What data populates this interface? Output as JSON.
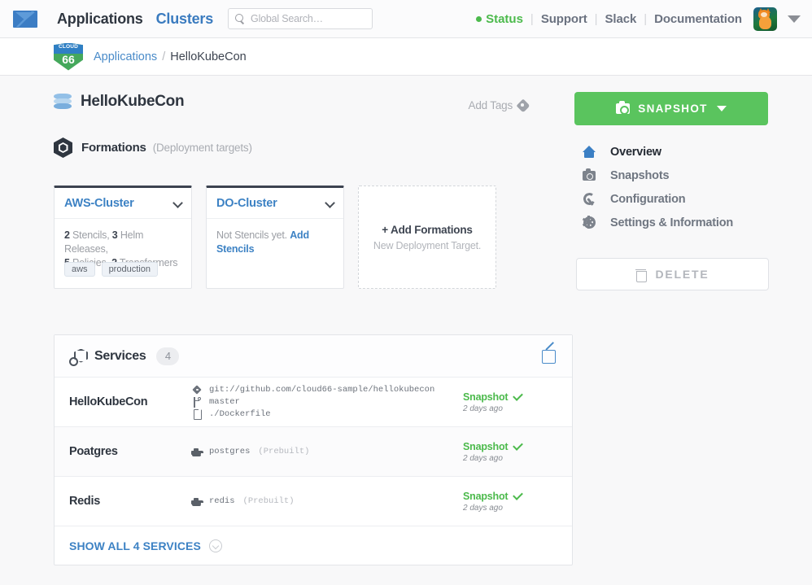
{
  "topnav": {
    "mail_icon": "mail-icon",
    "applications": "Applications",
    "clusters": "Clusters",
    "search_placeholder": "Global Search…",
    "status": "Status",
    "support": "Support",
    "slack": "Slack",
    "documentation": "Documentation",
    "separator": "|",
    "status_color": "#4cba4c"
  },
  "breadcrumb": {
    "logo_cloud": "CLOUD",
    "logo_num": "66",
    "parent": "Applications",
    "separator": "/",
    "current": "HelloKubeCon"
  },
  "header": {
    "app_title": "HelloKubeCon",
    "add_tags": "Add Tags",
    "snapshot_button": "SNAPSHOT",
    "snapshot_color": "#5ac45e"
  },
  "formations": {
    "title": "Formations",
    "subtitle": "(Deployment targets)",
    "cards": [
      {
        "name": "AWS-Cluster",
        "active": true,
        "stats": [
          {
            "count": "2",
            "label": "Stencils,"
          },
          {
            "count": "3",
            "label": "Helm Releases,"
          },
          {
            "count": "5",
            "label": "Policies,"
          },
          {
            "count": "2",
            "label": "Transformers"
          }
        ],
        "tags": [
          "aws",
          "production"
        ]
      },
      {
        "name": "DO-Cluster",
        "active": true,
        "empty_text": "Not Stencils yet.",
        "empty_link": "Add Stencils"
      }
    ],
    "add_card": {
      "title": "+ Add Formations",
      "subtitle": "New Deployment Target."
    }
  },
  "rightmenu": {
    "items": [
      {
        "label": "Overview",
        "icon": "home-icon",
        "active": true
      },
      {
        "label": "Snapshots",
        "icon": "camera-icon",
        "active": false
      },
      {
        "label": "Configuration",
        "icon": "wrench-icon",
        "active": false
      },
      {
        "label": "Settings & Information",
        "icon": "gear-icon",
        "active": false
      }
    ],
    "delete_button": "DELETE"
  },
  "services": {
    "title": "Services",
    "count": "4",
    "rows": [
      {
        "name": "HelloKubeCon",
        "lines": [
          {
            "icon": "git-icon",
            "text": "git://github.com/cloud66-sample/hellokubecon",
            "muted": ""
          },
          {
            "icon": "branch-icon",
            "text": "master",
            "muted": ""
          },
          {
            "icon": "file-icon",
            "text": "./Dockerfile",
            "muted": ""
          }
        ],
        "status": "Snapshot",
        "time": "2 days ago"
      },
      {
        "name": "Poatgres",
        "lines": [
          {
            "icon": "docker-icon",
            "text": "postgres",
            "muted": "(Prebuilt)"
          }
        ],
        "status": "Snapshot",
        "time": "2 days ago"
      },
      {
        "name": "Redis",
        "lines": [
          {
            "icon": "docker-icon",
            "text": "redis",
            "muted": "(Prebuilt)"
          }
        ],
        "status": "Snapshot",
        "time": "2 days ago"
      }
    ],
    "show_all_prefix": "SHOW ALL",
    "show_all_count": "4",
    "show_all_suffix": "SERVICES"
  }
}
